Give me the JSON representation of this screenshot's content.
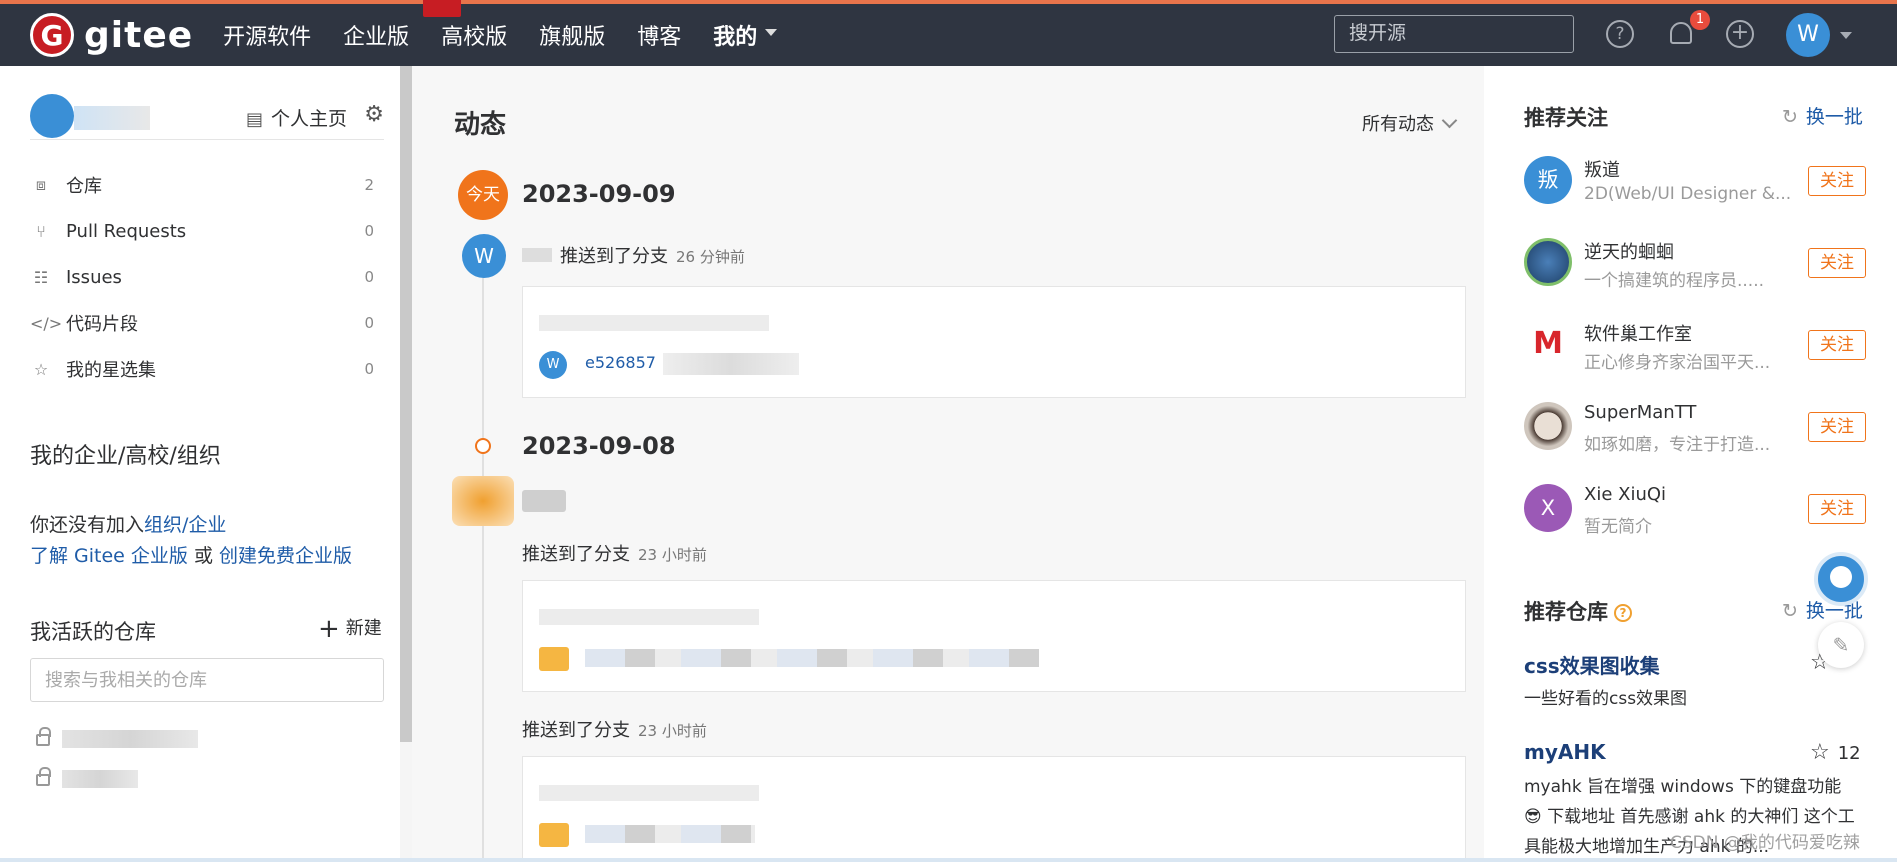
{
  "nav": {
    "logo_letter": "G",
    "logo_text": "gitee",
    "items": [
      "开源软件",
      "企业版",
      "高校版",
      "旗舰版",
      "博客",
      "我的"
    ],
    "search_placeholder": "搜开源",
    "help_symbol": "?",
    "add_symbol": "+",
    "notification_count": "1",
    "avatar_letter": "W"
  },
  "sidebar": {
    "home_link": "个人主页",
    "menu": [
      {
        "label": "仓库",
        "count": "2",
        "icon": "repo-icon"
      },
      {
        "label": "Pull Requests",
        "count": "0",
        "icon": "pull-request-icon"
      },
      {
        "label": "Issues",
        "count": "0",
        "icon": "issues-icon"
      },
      {
        "label": "代码片段",
        "count": "0",
        "icon": "code-snippet-icon"
      },
      {
        "label": "我的星选集",
        "count": "0",
        "icon": "star-collection-icon"
      }
    ],
    "org_title": "我的企业/高校/组织",
    "org_text_prefix": "你还没有加入",
    "org_link": "组织/企业",
    "enterprise_link": "了解 Gitee 企业版",
    "or_text": " 或 ",
    "create_link": "创建免费企业版",
    "active_title": "我活跃的仓库",
    "new_label": "新建",
    "repo_search_placeholder": "搜索与我相关的仓库"
  },
  "feed": {
    "title": "动态",
    "filter": "所有动态",
    "today_label": "今天",
    "groups": [
      {
        "date": "2023-09-09"
      },
      {
        "date": "2023-09-08"
      }
    ],
    "activities": [
      {
        "text": "推送到了分支",
        "time": "26 分钟前",
        "commit_avatar": "W",
        "sha": "e526857"
      },
      {
        "text": "推送到了分支",
        "time": "23 小时前"
      },
      {
        "text": "推送到了分支",
        "time": "23 小时前"
      }
    ],
    "avatar_letter": "W"
  },
  "right": {
    "follow_title": "推荐关注",
    "refresh_label": "换一批",
    "follows": [
      {
        "name": "叛道",
        "desc": "2D(Web/UI Designer &...",
        "avatar_text": "叛",
        "avatar_color": "#3a8fd6",
        "button": "关注"
      },
      {
        "name": "逆天的蛔蛔",
        "desc": "一个搞建筑的程序员.....",
        "avatar_text": "",
        "avatar_color": "#2b6aa8",
        "button": "关注"
      },
      {
        "name": "软件巢工作室",
        "desc": "正心修身齐家治国平天...",
        "avatar_text": "M",
        "avatar_color": "#ffffff",
        "button": "关注"
      },
      {
        "name": "SuperManTT",
        "desc": "如琢如磨，专注于打造...",
        "avatar_text": "",
        "avatar_color": "#d9d2ca",
        "button": "关注"
      },
      {
        "name": "Xie XiuQi",
        "desc": "暂无简介",
        "avatar_text": "X",
        "avatar_color": "#9b59b6",
        "button": "关注"
      }
    ],
    "repo_title": "推荐仓库",
    "help_symbol": "?",
    "repos": [
      {
        "name": "css效果图收集",
        "desc": "一些好看的css效果图",
        "stars": ""
      },
      {
        "name": "myAHK",
        "desc": "myahk 旨在增强 windows 下的键盘功能 😎 下载地址 首先感谢 ahk 的大神们 这个工具能极大地增加生产力 ahk 的...",
        "stars": "12"
      }
    ]
  },
  "watermark": "CSDN @我的代码爱吃辣",
  "colors": {
    "nav_bg": "#2f3541",
    "accent": "#f0741b",
    "link": "#1f5ca8",
    "brand": "#c71d23"
  }
}
